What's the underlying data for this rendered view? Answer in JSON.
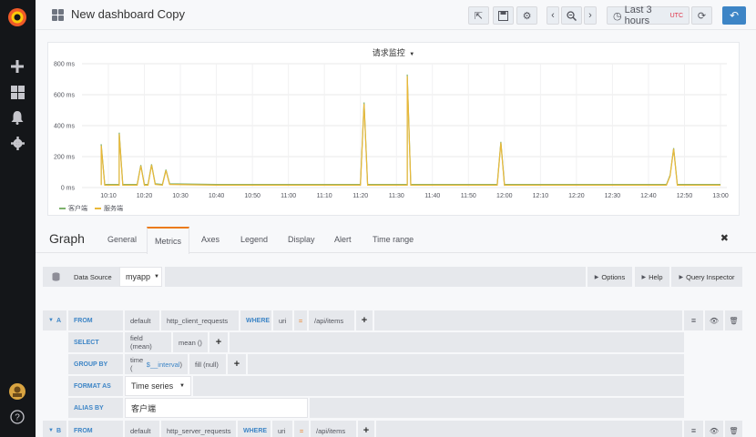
{
  "app": {
    "dashboard_title": "New dashboard Copy",
    "time_range": "Last 3 hours",
    "timezone": "UTC"
  },
  "panel": {
    "title": "请求监控"
  },
  "chart_data": {
    "type": "line",
    "title": "请求监控",
    "ylim": [
      0,
      800
    ],
    "y_ticks": [
      "800 ms",
      "600 ms",
      "400 ms",
      "200 ms",
      "0 ms"
    ],
    "x_ticks": [
      "10:10",
      "10:20",
      "10:30",
      "10:40",
      "10:50",
      "11:00",
      "11:10",
      "11:20",
      "11:30",
      "11:40",
      "11:50",
      "12:00",
      "12:10",
      "12:20",
      "12:30",
      "12:40",
      "12:50",
      "13:00"
    ],
    "grid": true,
    "legend": "bottom-left",
    "series": [
      {
        "name": "客户端",
        "color": "#7eb26d",
        "points": [
          [
            "10:08",
            20
          ],
          [
            "10:08",
            280
          ],
          [
            "10:09",
            20
          ],
          [
            "10:13",
            20
          ],
          [
            "10:13",
            355
          ],
          [
            "10:14",
            20
          ],
          [
            "10:18",
            20
          ],
          [
            "10:19",
            145
          ],
          [
            "10:20",
            20
          ],
          [
            "10:21",
            20
          ],
          [
            "10:22",
            150
          ],
          [
            "10:23",
            25
          ],
          [
            "10:25",
            20
          ],
          [
            "10:26",
            115
          ],
          [
            "10:27",
            25
          ],
          [
            "10:40",
            20
          ],
          [
            "11:08",
            20
          ],
          [
            "11:12",
            20
          ],
          [
            "11:20",
            20
          ],
          [
            "11:21",
            550
          ],
          [
            "11:22",
            20
          ],
          [
            "11:33",
            20
          ],
          [
            "11:33",
            730
          ],
          [
            "11:34",
            20
          ],
          [
            "11:58",
            20
          ],
          [
            "11:59",
            295
          ],
          [
            "12:00",
            20
          ],
          [
            "12:45",
            20
          ],
          [
            "12:46",
            80
          ],
          [
            "12:47",
            255
          ],
          [
            "12:48",
            20
          ],
          [
            "13:00",
            20
          ]
        ]
      },
      {
        "name": "服务端",
        "color": "#eab839",
        "points": [
          [
            "10:08",
            15
          ],
          [
            "10:08",
            270
          ],
          [
            "10:09",
            15
          ],
          [
            "10:13",
            15
          ],
          [
            "10:13",
            345
          ],
          [
            "10:14",
            15
          ],
          [
            "10:18",
            15
          ],
          [
            "10:19",
            140
          ],
          [
            "10:20",
            15
          ],
          [
            "10:21",
            15
          ],
          [
            "10:22",
            145
          ],
          [
            "10:23",
            20
          ],
          [
            "10:25",
            15
          ],
          [
            "10:26",
            110
          ],
          [
            "10:27",
            20
          ],
          [
            "10:40",
            15
          ],
          [
            "11:08",
            15
          ],
          [
            "11:12",
            15
          ],
          [
            "11:20",
            15
          ],
          [
            "11:21",
            540
          ],
          [
            "11:22",
            15
          ],
          [
            "11:33",
            15
          ],
          [
            "11:33",
            720
          ],
          [
            "11:34",
            15
          ],
          [
            "11:58",
            15
          ],
          [
            "11:59",
            290
          ],
          [
            "12:00",
            15
          ],
          [
            "12:45",
            15
          ],
          [
            "12:46",
            75
          ],
          [
            "12:47",
            250
          ],
          [
            "12:48",
            15
          ],
          [
            "13:00",
            15
          ]
        ]
      }
    ]
  },
  "editor": {
    "title": "Graph",
    "tabs": [
      "General",
      "Metrics",
      "Axes",
      "Legend",
      "Display",
      "Alert",
      "Time range"
    ],
    "active_tab": "Metrics",
    "close": "✖"
  },
  "datasource": {
    "label": "Data Source",
    "value": "myapp",
    "options_btn": "Options",
    "help_btn": "Help",
    "inspector_btn": "Query Inspector"
  },
  "query_a": {
    "ref": "A",
    "from_kw": "FROM",
    "policy": "default",
    "measurement": "http_client_requests",
    "where_kw": "WHERE",
    "tag": "uri",
    "op": "=",
    "tag_value": "/api/items",
    "select_kw": "SELECT",
    "field": "field (mean)",
    "fn": "mean ()",
    "groupby_kw": "GROUP BY",
    "time_pre": "time (",
    "time_var": "$__interval",
    "time_post": ")",
    "fill": "fill (null)",
    "format_kw": "FORMAT AS",
    "format_value": "Time series",
    "alias_kw": "ALIAS BY",
    "alias_value": "客户端"
  },
  "query_b": {
    "ref": "B",
    "from_kw": "FROM",
    "policy": "default",
    "measurement": "http_server_requests",
    "where_kw": "WHERE",
    "tag": "uri",
    "op": "=",
    "tag_value": "/api/items"
  },
  "icons": {
    "plus": "+",
    "menu": "≡",
    "eye": "👁",
    "trash": "🗑"
  }
}
